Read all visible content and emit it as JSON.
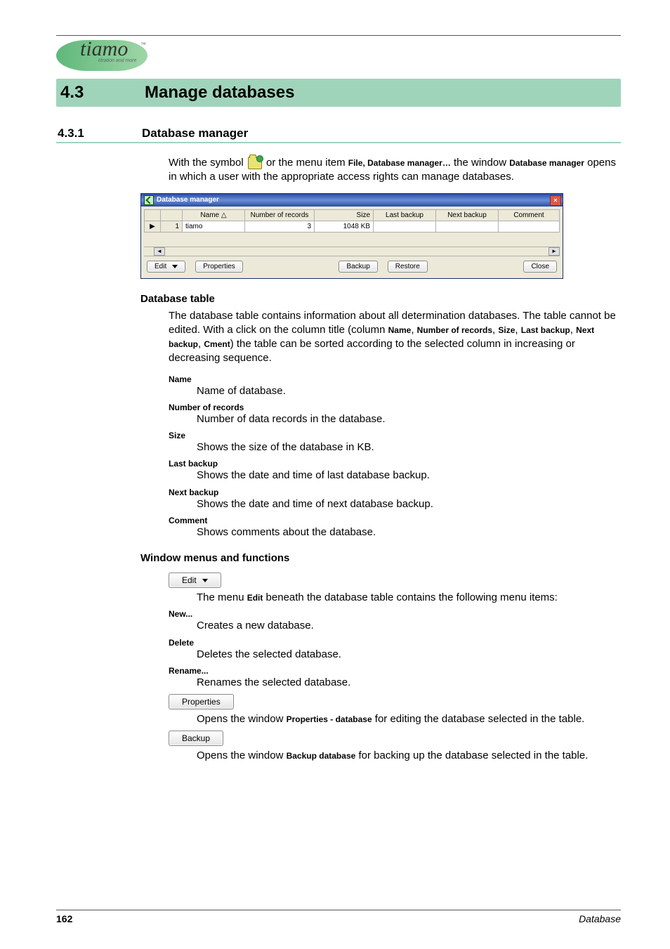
{
  "logo": {
    "brand": "tiamo",
    "tm": "™",
    "tagline": "titration and more"
  },
  "section": {
    "number": "4.3",
    "title": "Manage databases"
  },
  "subsection": {
    "number": "4.3.1",
    "title": "Database manager"
  },
  "intro": {
    "p1a": "With the symbol ",
    "p1b": " or the menu item ",
    "menuitem": "File, Database manager…",
    "p1c": " the window ",
    "winname": "Database manager",
    "p1d": " opens in which a user with the appropriate access rights can manage databases."
  },
  "screenshot": {
    "title": "Database manager",
    "close": "×",
    "headers": {
      "name": "Name △",
      "records": "Number of records",
      "size": "Size",
      "last": "Last backup",
      "next": "Next backup",
      "comment": "Comment"
    },
    "row_marker": "▶",
    "row_index": "1",
    "row": {
      "name": "tiamo",
      "records": "3",
      "size": "1048 KB",
      "last": "",
      "next": "",
      "comment": ""
    },
    "scroll_left": "◄",
    "scroll_right": "►",
    "buttons": {
      "edit": "Edit",
      "properties": "Properties",
      "backup": "Backup",
      "restore": "Restore",
      "close": "Close"
    }
  },
  "dbtable": {
    "heading": "Database table",
    "p1a": "The database table contains information about all determination databases. The table cannot be edited. With a click on the column title (column ",
    "c1": "Name",
    "sep": ", ",
    "c2": "Number of records",
    "c3": "Size",
    "c4": "Last backup",
    "c5": "Next backup",
    "c6": "Cment",
    "p1b": ") the table can be sorted according to the selected column in increasing or decreasing sequence.",
    "defs": {
      "name_t": "Name",
      "name_d": "Name of database.",
      "rec_t": "Number of records",
      "rec_d": "Number of data records in the database.",
      "size_t": "Size",
      "size_d": "Shows the size of the database in KB.",
      "last_t": "Last backup",
      "last_d": "Shows the date and time of last database backup.",
      "next_t": "Next backup",
      "next_d": "Shows the date and time of next database backup.",
      "comm_t": "Comment",
      "comm_d": "Shows comments about the database."
    }
  },
  "menus": {
    "heading": "Window menus and functions",
    "edit_btn": "Edit",
    "edit_p_a": "The menu ",
    "edit_p_b": "Edit",
    "edit_p_c": " beneath the database table contains the following menu items:",
    "new_t": "New...",
    "new_d": "Creates a new database.",
    "del_t": "Delete",
    "del_d": "Deletes the selected database.",
    "ren_t": "Rename...",
    "ren_d": "Renames the selected database.",
    "prop_btn": "Properties",
    "prop_p_a": "Opens the window ",
    "prop_p_b": "Properties - database",
    "prop_p_c": " for editing the database selected in the table.",
    "back_btn": "Backup",
    "back_p_a": "Opens the window ",
    "back_p_b": "Backup database",
    "back_p_c": " for backing up the database selected in the table."
  },
  "footer": {
    "page": "162",
    "section": "Database"
  }
}
